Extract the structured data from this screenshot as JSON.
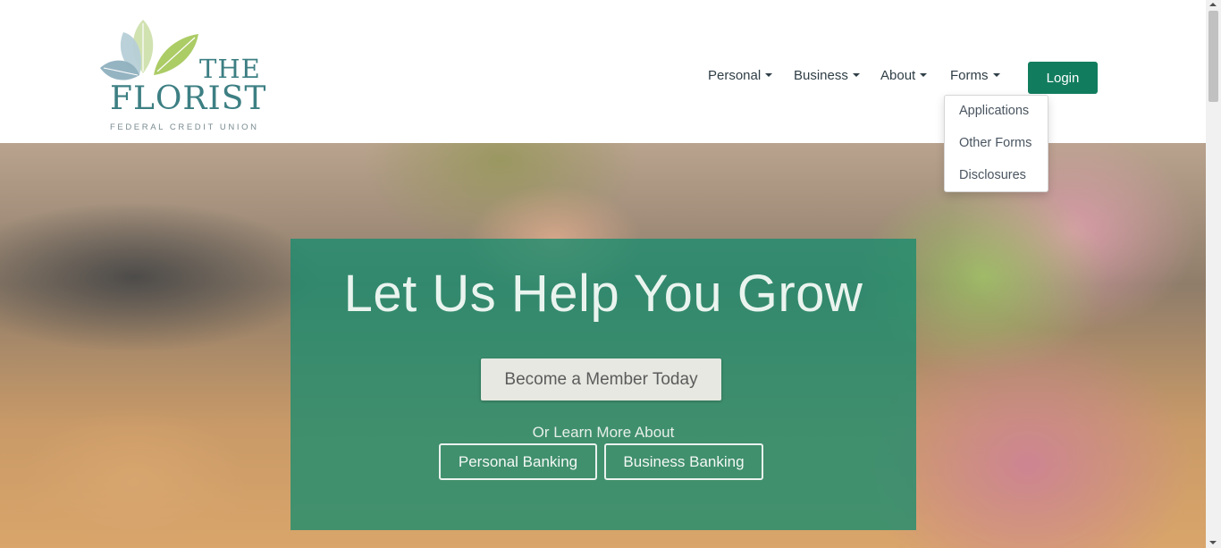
{
  "brand": {
    "line1": "THE",
    "line2": "FLORIST",
    "line3": "FEDERAL CREDIT UNION",
    "logo_colors": [
      "#8fb7c9",
      "#b8d07a",
      "#a3c46a",
      "#3d7f83"
    ]
  },
  "nav": {
    "items": [
      {
        "label": "Personal"
      },
      {
        "label": "Business"
      },
      {
        "label": "About"
      },
      {
        "label": "Forms"
      }
    ],
    "login_label": "Login"
  },
  "forms_dropdown": {
    "items": [
      {
        "label": "Applications"
      },
      {
        "label": "Other Forms"
      },
      {
        "label": "Disclosures"
      }
    ]
  },
  "hero": {
    "title": "Let Us Help You Grow",
    "cta_label": "Become a Member Today",
    "learn_more": "Or Learn More About",
    "personal_label": "Personal Banking",
    "business_label": "Business Banking"
  },
  "colors": {
    "accent": "#127d5e",
    "panel": "#188c6e",
    "text_dark": "#2f3e46"
  }
}
